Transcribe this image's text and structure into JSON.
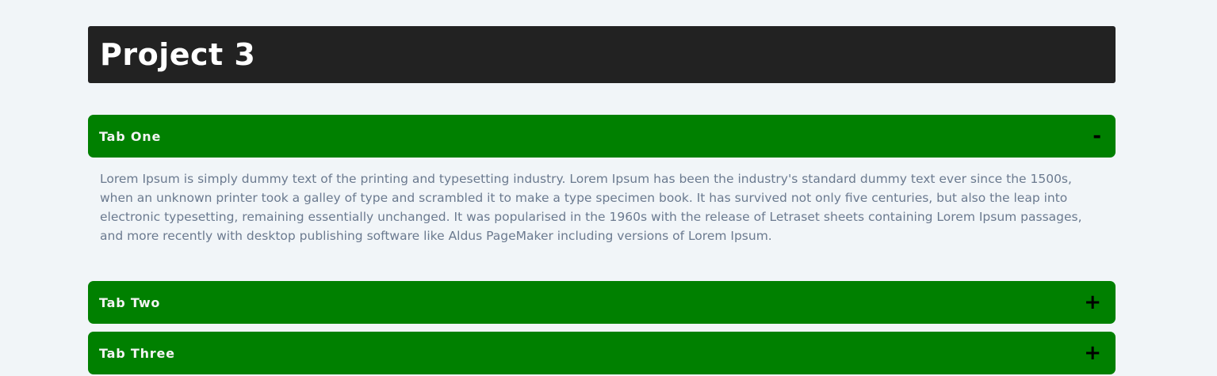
{
  "page": {
    "title": "Project 3"
  },
  "accordion": {
    "tabs": [
      {
        "title": "Tab One",
        "toggle": "-",
        "expanded": true,
        "content": "Lorem Ipsum is simply dummy text of the printing and typesetting industry. Lorem Ipsum has been the industry's standard dummy text ever since the 1500s, when an unknown printer took a galley of type and scrambled it to make a type specimen book. It has survived not only five centuries, but also the leap into electronic typesetting, remaining essentially unchanged. It was popularised in the 1960s with the release of Letraset sheets containing Lorem Ipsum passages, and more recently with desktop publishing software like Aldus PageMaker including versions of Lorem Ipsum."
      },
      {
        "title": "Tab Two",
        "toggle": "+",
        "expanded": false
      },
      {
        "title": "Tab Three",
        "toggle": "+",
        "expanded": false
      }
    ]
  },
  "colors": {
    "background": "#f1f5f8",
    "header": "#222222",
    "tab": "#008000",
    "panel_text": "#6b7a8f"
  }
}
